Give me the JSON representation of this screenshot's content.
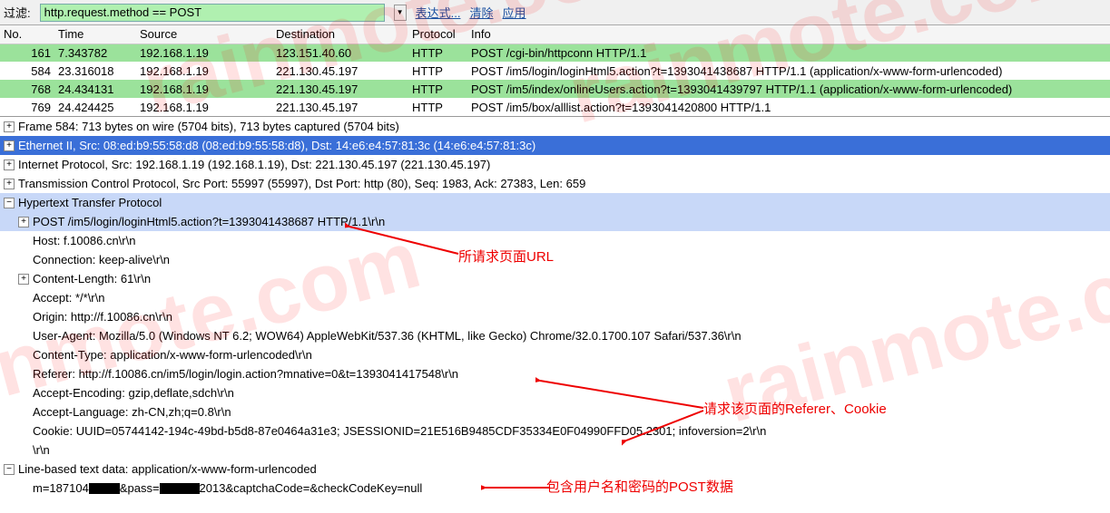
{
  "toolbar": {
    "filter_label": "过滤:",
    "filter_value": "http.request.method == POST",
    "expr": "表达式...",
    "clear": "清除",
    "apply": "应用"
  },
  "columns": {
    "no": "No.",
    "time": "Time",
    "source": "Source",
    "dest": "Destination",
    "proto": "Protocol",
    "info": "Info"
  },
  "packets": [
    {
      "cls": "row-green",
      "no": "161",
      "time": "7.343782",
      "src": "192.168.1.19",
      "dst": "123.151.40.60",
      "proto": "HTTP",
      "info": "POST /cgi-bin/httpconn HTTP/1.1"
    },
    {
      "cls": "row-white",
      "no": "584",
      "time": "23.316018",
      "src": "192.168.1.19",
      "dst": "221.130.45.197",
      "proto": "HTTP",
      "info": "POST /im5/login/loginHtml5.action?t=1393041438687 HTTP/1.1   (application/x-www-form-urlencoded)"
    },
    {
      "cls": "row-green",
      "no": "768",
      "time": "24.434131",
      "src": "192.168.1.19",
      "dst": "221.130.45.197",
      "proto": "HTTP",
      "info": "POST /im5/index/onlineUsers.action?t=1393041439797 HTTP/1.1   (application/x-www-form-urlencoded)"
    },
    {
      "cls": "row-white",
      "no": "769",
      "time": "24.424425",
      "src": "192.168.1.19",
      "dst": "221.130.45.197",
      "proto": "HTTP",
      "info": "POST /im5/box/alllist.action?t=1393041420800 HTTP/1.1"
    }
  ],
  "tree": {
    "frame": "Frame 584: 713 bytes on wire (5704 bits), 713 bytes captured (5704 bits)",
    "eth": "Ethernet II, Src: 08:ed:b9:55:58:d8 (08:ed:b9:55:58:d8), Dst: 14:e6:e4:57:81:3c (14:e6:e4:57:81:3c)",
    "ip": "Internet Protocol, Src: 192.168.1.19 (192.168.1.19), Dst: 221.130.45.197 (221.130.45.197)",
    "tcp": "Transmission Control Protocol, Src Port: 55997 (55997), Dst Port: http (80), Seq: 1983, Ack: 27383, Len: 659",
    "http": "Hypertext Transfer Protocol",
    "req": "POST /im5/login/loginHtml5.action?t=1393041438687 HTTP/1.1\\r\\n",
    "host": "Host: f.10086.cn\\r\\n",
    "conn": "Connection: keep-alive\\r\\n",
    "clen": "Content-Length: 61\\r\\n",
    "acc": "Accept: */*\\r\\n",
    "orig": "Origin: http://f.10086.cn\\r\\n",
    "ua": "User-Agent: Mozilla/5.0 (Windows NT 6.2; WOW64) AppleWebKit/537.36 (KHTML, like Gecko) Chrome/32.0.1700.107 Safari/537.36\\r\\n",
    "ctype": "Content-Type: application/x-www-form-urlencoded\\r\\n",
    "ref": "Referer: http://f.10086.cn/im5/login/login.action?mnative=0&t=1393041417548\\r\\n",
    "aenc": "Accept-Encoding: gzip,deflate,sdch\\r\\n",
    "alang": "Accept-Language: zh-CN,zh;q=0.8\\r\\n",
    "cookie": "Cookie: UUID=05744142-194c-49bd-b5d8-87e0464a31e3; JSESSIONID=21E516B9485CDF35334E0F04990FFD05.2301; infoversion=2\\r\\n",
    "crlf": "\\r\\n",
    "lbd": "Line-based text data: application/x-www-form-urlencoded",
    "post1": "m=187104",
    "post2": "&pass=",
    "post3": "2013&captchaCode=&checkCodeKey=null"
  },
  "anno": {
    "a1": "所请求页面URL",
    "a2": "请求该页面的Referer、Cookie",
    "a3": "包含用户名和密码的POST数据"
  },
  "wm": "rainmote.com"
}
